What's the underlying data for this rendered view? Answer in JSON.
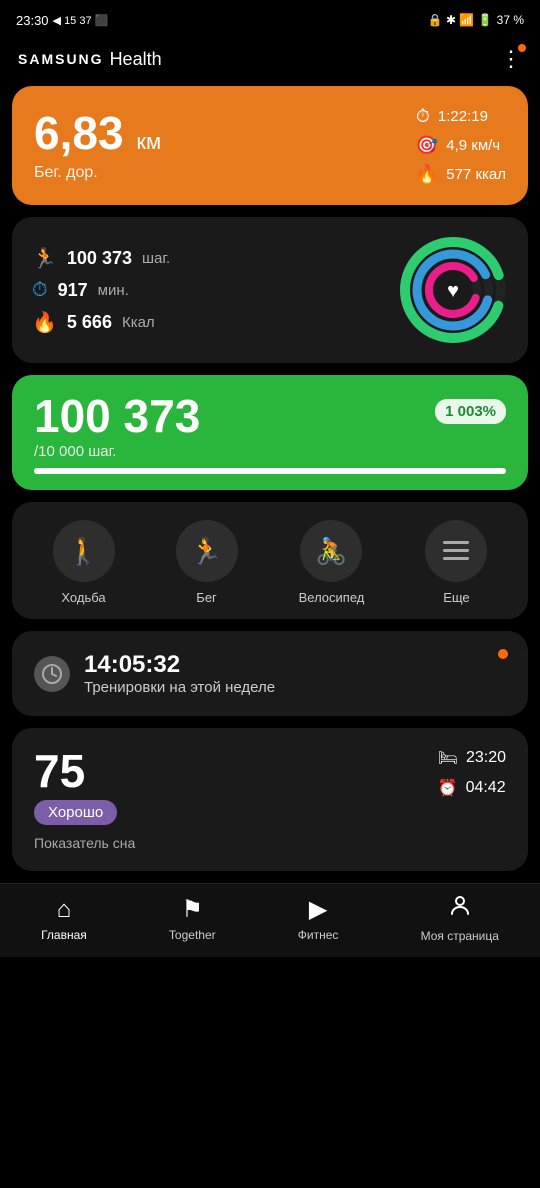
{
  "statusBar": {
    "time": "23:30",
    "batteryPercent": "37 %"
  },
  "header": {
    "logoSamsung": "SAMSUNG",
    "logoHealth": "Health",
    "menuIcon": "⋮"
  },
  "workoutCard": {
    "distance": "6,83",
    "distanceUnit": "км",
    "workoutType": "Бег. дор.",
    "duration": "1:22:19",
    "speed": "4,9 км/ч",
    "calories": "577 ккал"
  },
  "activityCard": {
    "steps": "100 373",
    "stepsUnit": "шаг.",
    "minutes": "917",
    "minutesUnit": "мин.",
    "kcal": "5 666",
    "kcalUnit": "Ккал"
  },
  "stepsCard": {
    "steps": "100 373",
    "goal": "/10 000 шаг.",
    "badge": "1 003%",
    "progressPercent": 100
  },
  "activitiesCard": {
    "buttons": [
      {
        "icon": "🚶",
        "label": "Ходьба"
      },
      {
        "icon": "🏃",
        "label": "Бег"
      },
      {
        "icon": "🚴",
        "label": "Велосипед"
      },
      {
        "icon": "☰",
        "label": "Еще"
      }
    ]
  },
  "trainingCard": {
    "time": "14:05:32",
    "label": "Тренировки на этой неделе"
  },
  "sleepCard": {
    "score": "75",
    "badge": "Хорошо",
    "label": "Показатель сна",
    "bedTime": "23:20",
    "wakeTime": "04:42"
  },
  "bottomNav": [
    {
      "icon": "🏠",
      "label": "Главная",
      "active": true
    },
    {
      "icon": "🚩",
      "label": "Together",
      "active": false
    },
    {
      "icon": "▶",
      "label": "Фитнес",
      "active": false
    },
    {
      "icon": "👤",
      "label": "Моя страница",
      "active": false
    }
  ]
}
